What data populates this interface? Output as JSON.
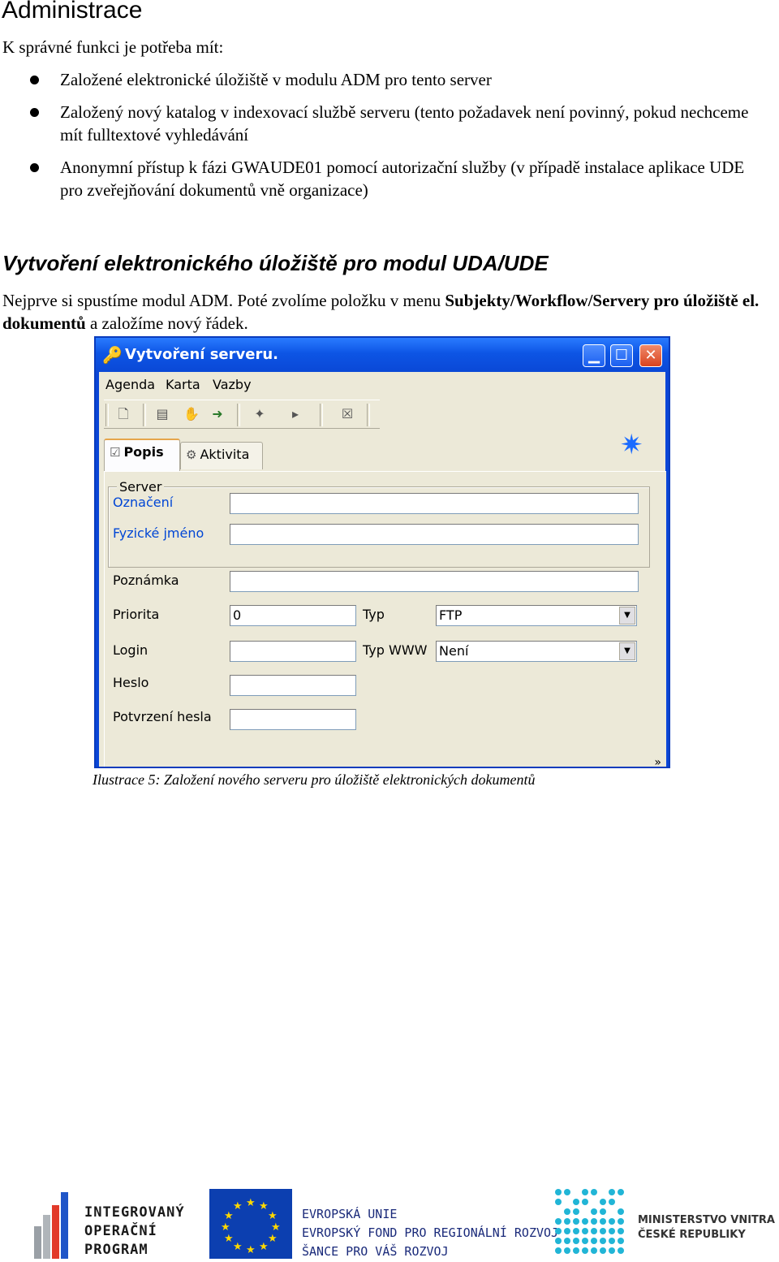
{
  "heading": "Administrace",
  "intro": "K správné funkci je potřeba mít:",
  "requirements": [
    "Založené elektronické úložiště v modulu ADM pro tento server",
    "Založený nový katalog v indexovací službě serveru (tento požadavek není povinný, pokud nechceme mít fulltextové vyhledávání",
    "Anonymní přístup k fázi GWAUDE01 pomocí autorizační služby (v případě instalace aplikace UDE pro zveřejňování dokumentů vně organizace)"
  ],
  "section_heading": "Vytvoření elektronického úložiště pro modul UDA/UDE",
  "paragraph": {
    "part1": "Nejprve si spustíme modul ADM. Poté zvolíme položku v menu ",
    "bold1": "Subjekty/Workflow/Servery pro úložiště el. dokumentů",
    "part2": " a založíme nový řádek."
  },
  "window": {
    "title": "Vytvoření serveru.",
    "menu": [
      "Agenda",
      "Karta",
      "Vazby"
    ],
    "tabs": [
      "Popis",
      "Aktivita"
    ],
    "group_label": "Server",
    "labels": {
      "oznaceni": "Označení",
      "fyzicke_jmeno": "Fyzické jméno",
      "poznamka": "Poznámka",
      "priorita": "Priorita",
      "typ": "Typ",
      "login": "Login",
      "typ_www": "Typ WWW",
      "heslo": "Heslo",
      "potvrzeni_hesla": "Potvrzení hesla"
    },
    "values": {
      "oznaceni": "",
      "fyzicke_jmeno": "",
      "poznamka": "",
      "priorita": "0",
      "typ": "FTP",
      "login": "",
      "typ_www": "Není",
      "heslo": "",
      "potvrzeni_hesla": ""
    },
    "more": "»"
  },
  "caption": "Ilustrace 5: Založení nového serveru pro úložiště elektronických dokumentů",
  "footer": {
    "iop": [
      "INTEGROVANÝ",
      "OPERAČNÍ",
      "PROGRAM"
    ],
    "eu": [
      "EVROPSKÁ UNIE",
      "EVROPSKÝ FOND PRO REGIONÁLNÍ ROZVOJ",
      "ŠANCE PRO VÁŠ ROZVOJ"
    ],
    "mv": [
      "MINISTERSTVO VNITRA",
      "ČESKÉ REPUBLIKY"
    ]
  },
  "icons": {
    "title": "key-icon",
    "tools": [
      "new-document-icon",
      "edit-icon",
      "stop-hand-icon",
      "run-icon",
      "puzzle-icon",
      "play-arrow-icon",
      "close-box-icon"
    ],
    "corner": "new-star-document-icon"
  }
}
